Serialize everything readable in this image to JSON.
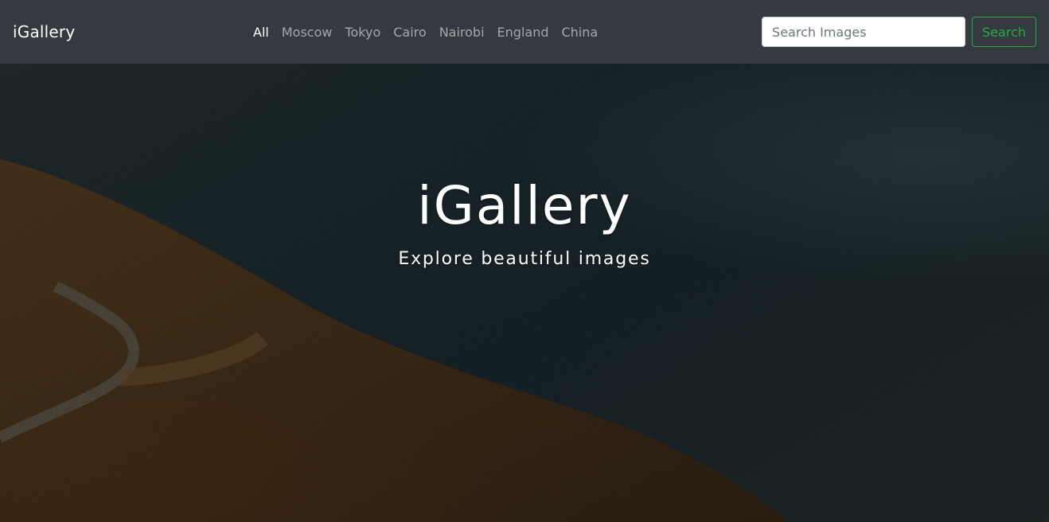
{
  "navbar": {
    "brand": "iGallery",
    "links": [
      {
        "label": "All",
        "active": true
      },
      {
        "label": "Moscow",
        "active": false
      },
      {
        "label": "Tokyo",
        "active": false
      },
      {
        "label": "Cairo",
        "active": false
      },
      {
        "label": "Nairobi",
        "active": false
      },
      {
        "label": "England",
        "active": false
      },
      {
        "label": "China",
        "active": false
      }
    ],
    "search": {
      "placeholder": "Search Images",
      "value": "",
      "button_label": "Search"
    }
  },
  "hero": {
    "title": "iGallery",
    "subtitle": "Explore beautiful images"
  },
  "colors": {
    "navbar_bg": "#343a40",
    "search_button_accent": "#28a745"
  }
}
